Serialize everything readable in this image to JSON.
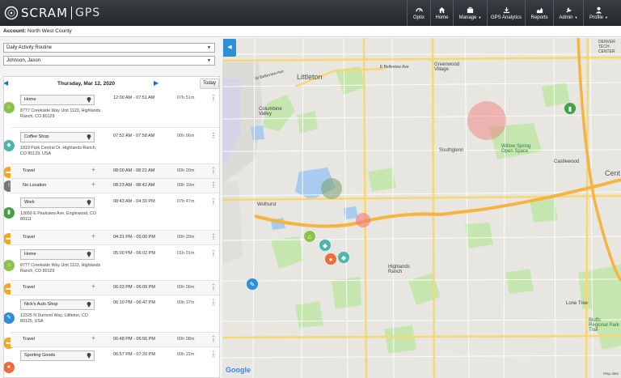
{
  "brand": {
    "name": "SCRAM",
    "sub": "GPS"
  },
  "nav": [
    {
      "label": "Optix",
      "icon": "dashboard-icon",
      "dropdown": false
    },
    {
      "label": "Home",
      "icon": "home-icon",
      "dropdown": false
    },
    {
      "label": "Manage",
      "icon": "briefcase-icon",
      "dropdown": true
    },
    {
      "label": "GPS Analytics",
      "icon": "download-icon",
      "dropdown": false
    },
    {
      "label": "Reports",
      "icon": "chart-icon",
      "dropdown": false
    },
    {
      "label": "Admin",
      "icon": "wrench-icon",
      "dropdown": true
    },
    {
      "label": "Profile",
      "icon": "user-icon",
      "dropdown": true
    }
  ],
  "account": {
    "label": "Account:",
    "value": "North West County"
  },
  "filters": {
    "report": "Daily Activity Routine",
    "person": "Johnson, Jason"
  },
  "timeline": {
    "date": "Thursday, Mar 12, 2020",
    "today": "Today",
    "entries": [
      {
        "type": "place",
        "name": "Home",
        "address": "8777 Creekside Way Unit 1123, Highlands Ranch, CO 80129",
        "time": "12:00 AM - 07:51 AM",
        "duration": "07h 51m"
      },
      {
        "type": "place",
        "name": "Coffee Shop",
        "address": "1819 Park Central Dr, Highlands Ranch, CO 80129, USA",
        "time": "07:52 AM - 07:58 AM",
        "duration": "00h 06m"
      },
      {
        "type": "travel",
        "name": "Travel",
        "time": "08:00 AM - 08:21 AM",
        "duration": "00h 20m"
      },
      {
        "type": "travel",
        "name": "No Location",
        "time": "08:23 AM - 08:42 AM",
        "duration": "00h 19m"
      },
      {
        "type": "place",
        "name": "Work",
        "address": "13059 E Peakview Ave, Englewood, CO 80111",
        "time": "08:43 AM - 04:30 PM",
        "duration": "07h 47m"
      },
      {
        "type": "travel",
        "name": "Travel",
        "time": "04:31 PM - 05:00 PM",
        "duration": "00h 29m"
      },
      {
        "type": "place",
        "name": "Home",
        "address": "8777 Creekside Way Unit 1123, Highlands Ranch, CO 80129",
        "time": "05:00 PM - 06:02 PM",
        "duration": "01h 01m"
      },
      {
        "type": "travel",
        "name": "Travel",
        "time": "06:03 PM - 06:09 PM",
        "duration": "00h 06m"
      },
      {
        "type": "place",
        "name": "Nick's Auto Shop",
        "address": "12325 N Dumont Way, Littleton, CO 80125, USA",
        "time": "06:10 PM - 06:47 PM",
        "duration": "00h 37m"
      },
      {
        "type": "travel",
        "name": "Travel",
        "time": "06:48 PM - 06:56 PM",
        "duration": "00h 08m"
      },
      {
        "type": "place",
        "name": "Sporting Goods",
        "time": "06:57 PM - 07:20 PM",
        "duration": "00h 22m"
      }
    ]
  },
  "map": {
    "labels": {
      "littleton": "Littleton",
      "columbine": "Columbine Valley",
      "greenwood": "Greenwood Village",
      "centennial": "Centennial",
      "southglenn": "Southglenn",
      "willow": "Willow Spring Open Space",
      "castlewood": "Castlewood",
      "denver_tech": "DENVER TECH CENTER",
      "cent": "Cent",
      "wolhurst": "Wolhurst",
      "highlands": "Highlands Ranch",
      "lone_tree": "Lone Tree",
      "bluffs": "Bluffs Regional Park Trail",
      "belleview": "E Belleview Ave",
      "w_belleview": "W Belleview Ave"
    },
    "google": "Google",
    "attribution": "Map data"
  },
  "colors": {
    "home": "#8bc34a",
    "coffee": "#4db6ac",
    "travel": "#f5a623",
    "no_location": "#777777",
    "work": "#43a047",
    "auto": "#2d8fd5",
    "store": "#ef6c3a",
    "accent": "#2d8fd5"
  }
}
